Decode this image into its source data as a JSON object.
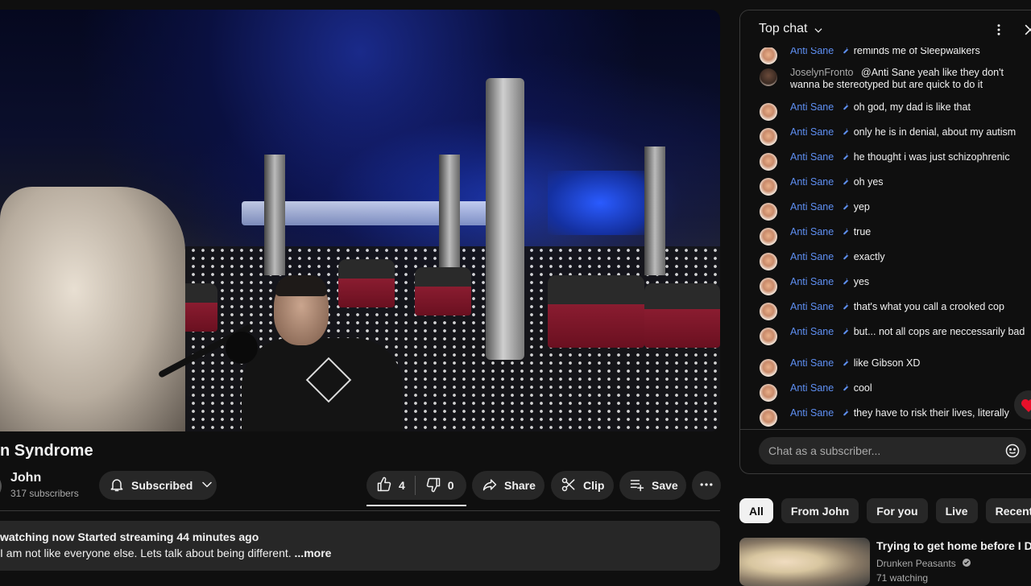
{
  "video": {
    "title": "n Syndrome"
  },
  "channel": {
    "name": "John",
    "subscribers": "317 subscribers",
    "subscribe_label": "Subscribed"
  },
  "actions": {
    "likes": "4",
    "dislikes": "0",
    "share": "Share",
    "clip": "Clip",
    "save": "Save"
  },
  "description": {
    "stats": "watching now  Started streaming 44 minutes ago",
    "text": "I am not like everyone else. Lets talk about being different. ",
    "more": "...more"
  },
  "chat": {
    "mode_label": "Top chat",
    "input_placeholder": "Chat as a subscriber...",
    "messages": [
      {
        "author": "Anti Sane",
        "text": "reminds me of Sleepwalkers",
        "moderator": true
      },
      {
        "author": "JoselynFronto",
        "text": "@Anti Sane yeah like they don't wanna be stereotyped but are quick to do it",
        "moderator": false
      },
      {
        "author": "Anti Sane",
        "text": "oh god, my dad is like that",
        "moderator": true
      },
      {
        "author": "Anti Sane",
        "text": "only he is in denial, about my autism",
        "moderator": true
      },
      {
        "author": "Anti Sane",
        "text": "he thought i was just schizophrenic",
        "moderator": true
      },
      {
        "author": "Anti Sane",
        "text": "oh yes",
        "moderator": true
      },
      {
        "author": "Anti Sane",
        "text": "yep",
        "moderator": true
      },
      {
        "author": "Anti Sane",
        "text": "true",
        "moderator": true
      },
      {
        "author": "Anti Sane",
        "text": "exactly",
        "moderator": true
      },
      {
        "author": "Anti Sane",
        "text": "yes",
        "moderator": true
      },
      {
        "author": "Anti Sane",
        "text": "that's what you call a crooked cop",
        "moderator": true
      },
      {
        "author": "Anti Sane",
        "text": "but... not all cops are neccessarily bad",
        "moderator": true
      },
      {
        "author": "Anti Sane",
        "text": "like Gibson XD",
        "moderator": true
      },
      {
        "author": "Anti Sane",
        "text": "cool",
        "moderator": true
      },
      {
        "author": "Anti Sane",
        "text": "they have to risk their lives, literally",
        "moderator": true
      }
    ]
  },
  "chips": [
    "All",
    "From John",
    "For you",
    "Live",
    "Recently"
  ],
  "recommended": {
    "title": "Trying to get home before I DIE!",
    "channel": "Drunken Peasants",
    "watching": "71 watching"
  },
  "colors": {
    "background": "#0f0f0f",
    "surface": "#272727",
    "moderator_name": "#5e8ff2",
    "text": "#f1f1f1",
    "muted": "#aaaaaa"
  }
}
